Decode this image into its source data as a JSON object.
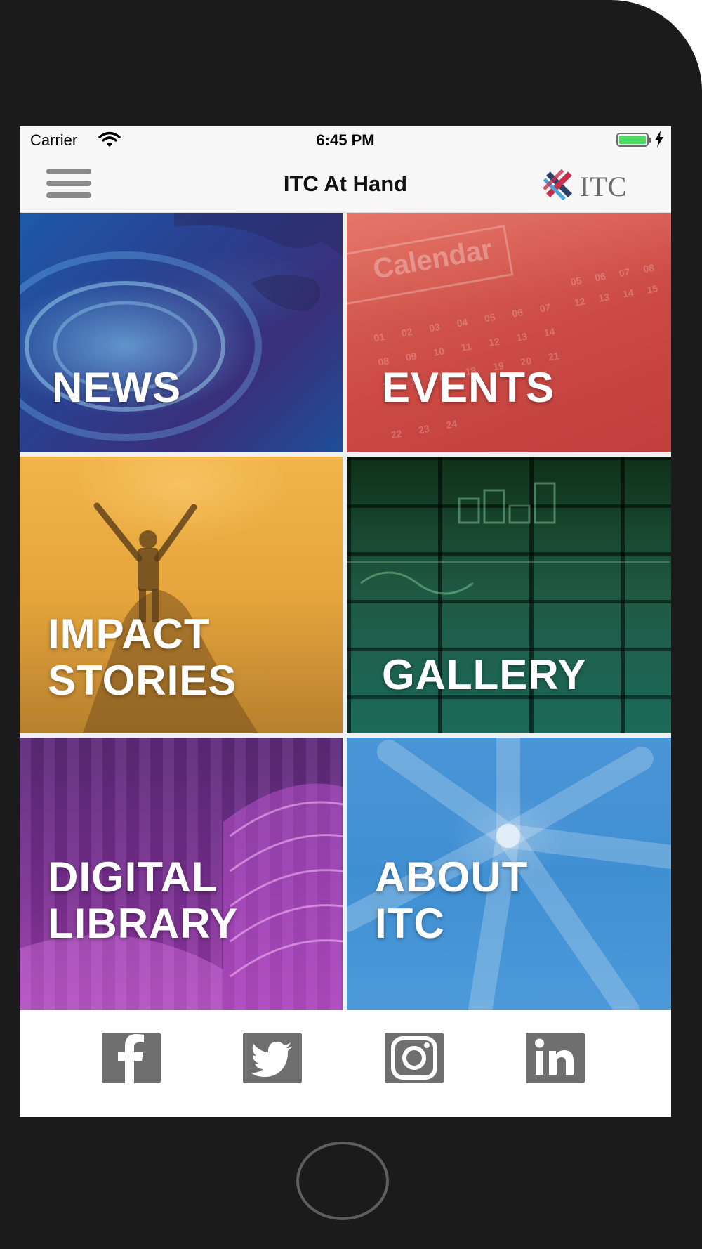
{
  "status_bar": {
    "carrier": "Carrier",
    "time": "6:45 PM",
    "battery_level": 1.0,
    "battery_color": "#4cd964"
  },
  "nav": {
    "title": "ITC At Hand",
    "menu_icon": "hamburger-icon",
    "brand_text": "ITC"
  },
  "tiles": [
    {
      "id": "news",
      "label": "NEWS",
      "color": "#2a4a9a"
    },
    {
      "id": "events",
      "label": "EVENTS",
      "color": "#cc4a44"
    },
    {
      "id": "impact",
      "label": "IMPACT\nSTORIES",
      "color": "#e6a53c"
    },
    {
      "id": "gallery",
      "label": "GALLERY",
      "color": "#1f5a44"
    },
    {
      "id": "library",
      "label": "DIGITAL\nLIBRARY",
      "color": "#7a2f92"
    },
    {
      "id": "about",
      "label": "ABOUT\nITC",
      "color": "#3f8fd3"
    }
  ],
  "decor": {
    "calendar_word": "Calendar"
  },
  "social": [
    {
      "id": "facebook",
      "icon": "facebook-icon"
    },
    {
      "id": "twitter",
      "icon": "twitter-icon"
    },
    {
      "id": "instagram",
      "icon": "instagram-icon"
    },
    {
      "id": "linkedin",
      "icon": "linkedin-icon"
    }
  ],
  "colors": {
    "bar_background": "#f7f7f7",
    "social_icon": "#6f6f6f",
    "device_frame": "#1b1b1b"
  }
}
